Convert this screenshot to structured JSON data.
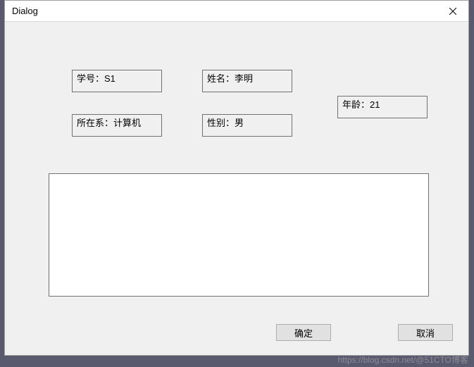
{
  "title": "Dialog",
  "fields": {
    "id": {
      "label": "学号：",
      "value": "S1"
    },
    "name": {
      "label": "姓名：",
      "value": "李明"
    },
    "age": {
      "label": "年龄：",
      "value": "21"
    },
    "dept": {
      "label": "所在系：",
      "value": "计算机"
    },
    "gender": {
      "label": "性别：",
      "value": "男"
    }
  },
  "buttons": {
    "ok": "确定",
    "cancel": "取消"
  },
  "watermark": "https://blog.csdn.net/@51CTO博客"
}
